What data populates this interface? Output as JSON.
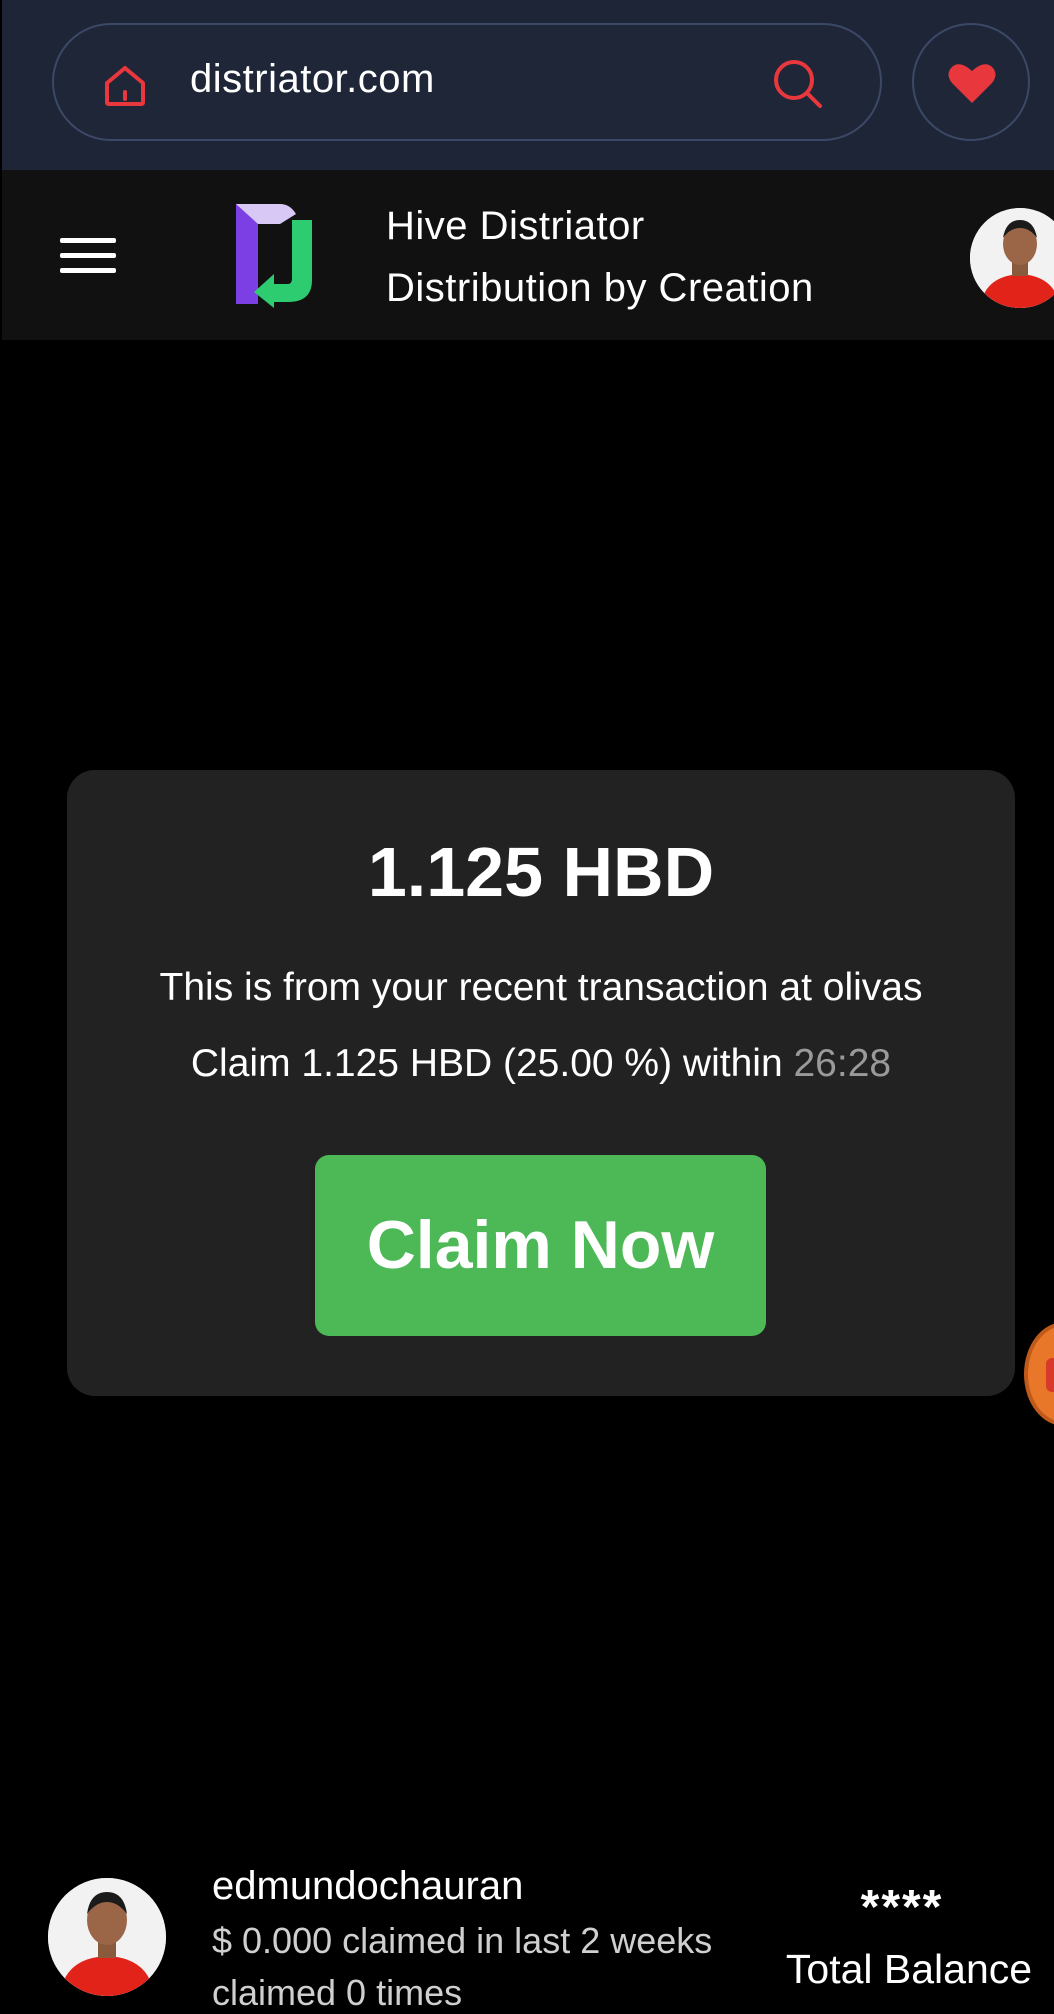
{
  "browser": {
    "url": "distriator.com",
    "accent_color": "#e8383d"
  },
  "header": {
    "title": "Hive Distriator",
    "subtitle": "Distribution by Creation",
    "logo_colors": [
      "#7b3fe4",
      "#2ecc71"
    ]
  },
  "claim": {
    "amount": "1.125 HBD",
    "description": "This is from your recent transaction at olivas",
    "claim_text": "Claim 1.125 HBD (25.00 %) within",
    "timer": "26:28",
    "button_label": "Claim Now",
    "button_color": "#4cb856"
  },
  "user": {
    "username": "edmundochauran",
    "claimed_summary": "$ 0.000 claimed in last 2 weeks",
    "claimed_times": "claimed 0 times",
    "balance_masked": "****",
    "balance_label": "Total Balance"
  }
}
